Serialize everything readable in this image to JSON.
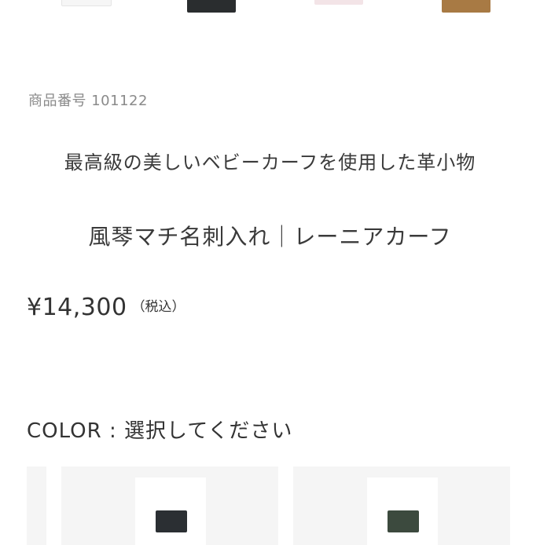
{
  "thumbnails": [
    {
      "name": "white-case",
      "color": "#f6f6f6"
    },
    {
      "name": "black-case",
      "color": "#2a2d2f"
    },
    {
      "name": "pink-case",
      "color": "#f3e4e7"
    },
    {
      "name": "brown-case",
      "color": "#a87a44"
    }
  ],
  "product": {
    "code_label": "商品番号 101122",
    "subtitle": "最高級の美しいベビーカーフを使用した革小物",
    "title": "風琴マチ名刺入れ｜レーニアカーフ",
    "price": "¥14,300",
    "tax_note": "（税込）"
  },
  "color_select": {
    "label": "COLOR : 選択してください",
    "swatches": [
      {
        "name": "black",
        "color": "#2b2f33"
      },
      {
        "name": "dark-green",
        "color": "#3c4a3e"
      }
    ]
  }
}
